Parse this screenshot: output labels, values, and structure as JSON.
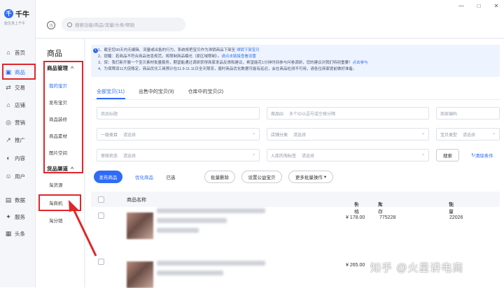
{
  "app": {
    "logo_mark": "千",
    "logo_text": "千牛",
    "logo_sub": "能生意上千牛"
  },
  "rail": [
    {
      "label": "首页",
      "icon": "home-icon",
      "glyph": "⌂"
    },
    {
      "label": "商品",
      "icon": "product-icon",
      "glyph": "▣"
    },
    {
      "label": "交易",
      "icon": "trade-icon",
      "glyph": "⇄"
    },
    {
      "label": "店铺",
      "icon": "store-icon",
      "glyph": "⌂"
    },
    {
      "label": "营销",
      "icon": "marketing-icon",
      "glyph": "◎"
    },
    {
      "label": "推广",
      "icon": "promote-icon",
      "glyph": "↗"
    },
    {
      "label": "内容",
      "icon": "content-icon",
      "glyph": "◐"
    },
    {
      "label": "用户",
      "icon": "user-icon",
      "glyph": "☺"
    },
    {
      "label": "数据",
      "icon": "data-icon",
      "glyph": "▤"
    },
    {
      "label": "服务",
      "icon": "service-icon",
      "glyph": "✦"
    },
    {
      "label": "头条",
      "icon": "news-icon",
      "glyph": "▦"
    }
  ],
  "search": {
    "placeholder": "搜索功能/商品/流量/头条/帮助"
  },
  "subnav": {
    "title": "商品",
    "group1": {
      "label": "商品管理",
      "items": [
        "我的宝贝",
        "发布宝贝",
        "商品装修",
        "商品素材",
        "图片空间"
      ]
    },
    "group2": {
      "label": "货品渠道",
      "items": [
        "淘货源",
        "淘商机",
        "淘分销"
      ]
    }
  },
  "notice": [
    {
      "text": "1、截至您90天内无编辑、流量或出售的行为，系统将把宝贝作为滞销商品下架至 ",
      "link": "滞销下架宝贝"
    },
    {
      "text": "2、提醒：若商品不符合商品信息规范，将限制商品曝光（原区域限制）。",
      "link": "请点击链接查看设置"
    },
    {
      "text": "3、保：我们新开展一个宝贝素材批量服务，期望能通过调研获得商家发品反馈和建议，希望能花1分钟时间参与问卷调研，您的建议对我们特别重要！",
      "link": "点击参与"
    },
    {
      "text": "4、为保障双11大促稳定，商品优化工具预计在11.9-11.11日全天限流，届时商品优化数据可能有延迟，会在商品检测不可用，请各位商家提前做好准备。",
      "link": ""
    }
  ],
  "tabs": [
    "全部宝贝(11)",
    "出售中的宝贝(9)",
    "仓库中的宝贝(2)"
  ],
  "filters": {
    "title_placeholder": "商品标题",
    "id_label": "商品ID",
    "id_placeholder": "多个ID以逗号或空格分隔",
    "code_placeholder": "商家编码",
    "cat1_label": "一级类目",
    "cat1_placeholder": "请选择",
    "shopcat_label": "店铺分类",
    "shopcat_placeholder": "请选择",
    "type_label": "宝贝类型",
    "type_placeholder": "请选择",
    "audit_label": "审核状态",
    "audit_placeholder": "请选择",
    "stock_label": "入库的淘标签",
    "stock_placeholder": "请选择",
    "search_button": "搜索",
    "clear_button": "清除条件",
    "clear_icon": "refresh-icon"
  },
  "actions": {
    "publish": "发布商品",
    "optimize": "优化商品",
    "selected": "已选",
    "batch_delete": "批量删除",
    "set_public": "设置公益宝贝",
    "more_batch": "更多批量操作"
  },
  "table": {
    "headers": {
      "name": "商品名称",
      "price": "价格",
      "stock": "库存",
      "sales": "销量"
    },
    "rows": [
      {
        "price": "¥ 178.00",
        "stock": "775228",
        "sales": "22026"
      },
      {
        "price": "¥ 265.00",
        "stock": "",
        "sales": ""
      }
    ]
  },
  "watermark": "知乎 @火星讲电商",
  "colors": {
    "accent": "#2f6cf6",
    "highlight": "#e0262b"
  }
}
